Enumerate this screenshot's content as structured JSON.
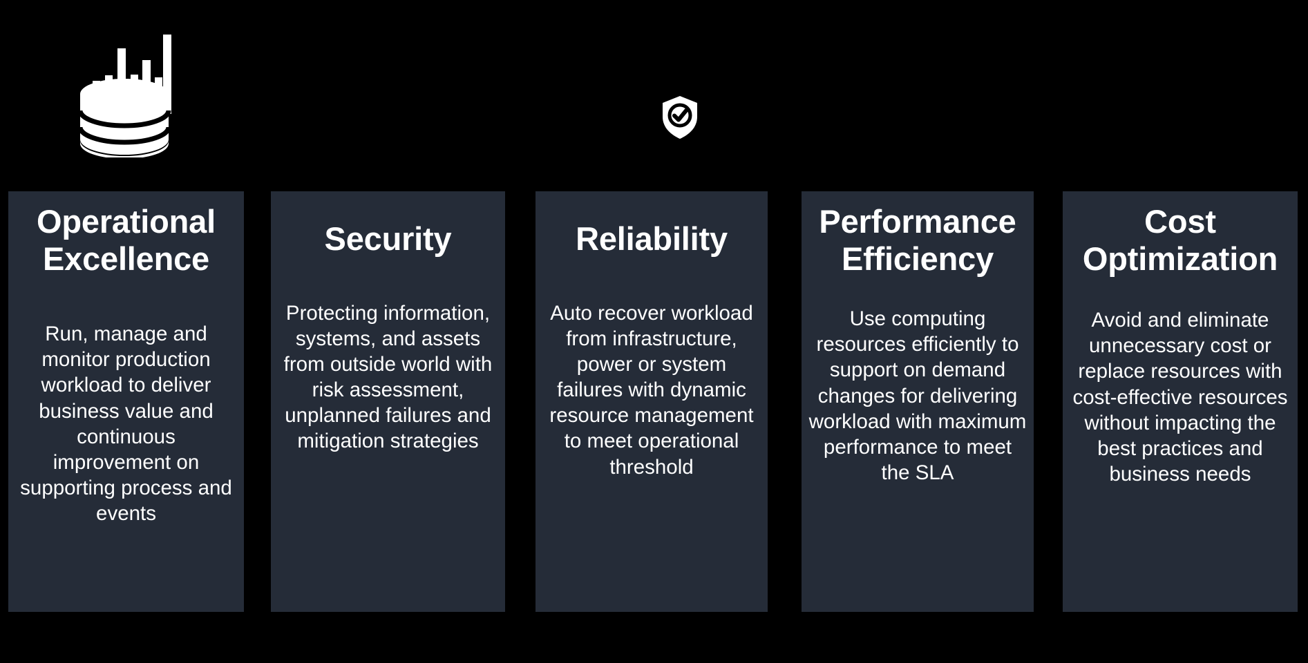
{
  "background_color": "#000000",
  "card_color": "#252c38",
  "text_color": "#ffffff",
  "icons": [
    {
      "name": "database-analytics-icon",
      "label": "database with bar chart"
    },
    {
      "name": "shield-check-icon",
      "label": "shield with check mark"
    }
  ],
  "cards": [
    {
      "title": "Operational Excellence",
      "body": "Run, manage and monitor production workload to deliver business value and continuous improvement on supporting process and events"
    },
    {
      "title": "Security",
      "body": "Protecting information, systems, and assets from outside world with risk assessment, unplanned failures and mitigation strategies"
    },
    {
      "title": "Reliability",
      "body": "Auto recover workload from infrastructure, power or system failures with dynamic resource management to meet operational threshold"
    },
    {
      "title": "Performance Efficiency",
      "body": "Use computing resources efficiently to support on demand changes for delivering workload with maximum performance to meet the SLA"
    },
    {
      "title": "Cost Optimization",
      "body": "Avoid and eliminate unnecessary cost or replace resources with cost-effective resources without impacting the best practices and business needs"
    }
  ]
}
